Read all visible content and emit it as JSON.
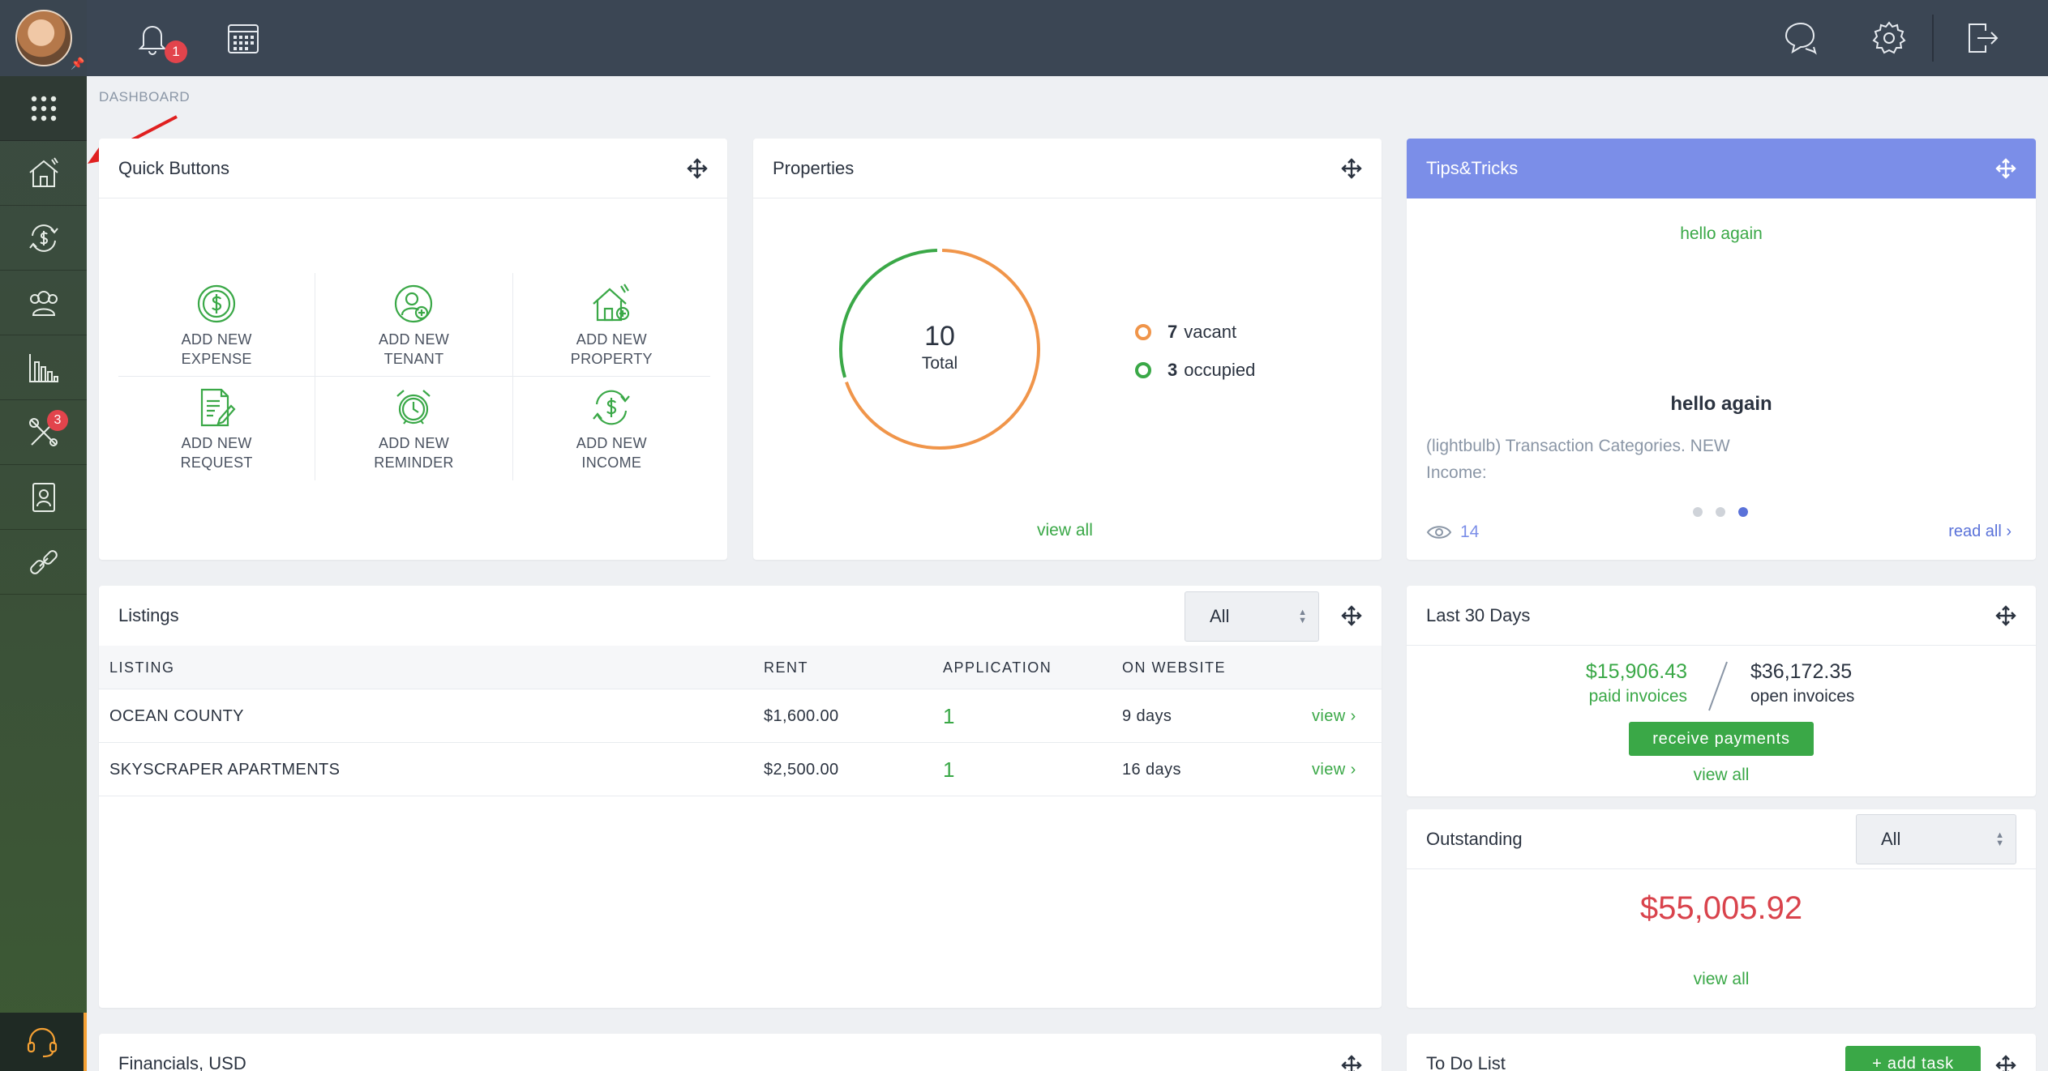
{
  "topbar": {
    "bell_count": "1"
  },
  "sidebar": {
    "tools_badge": "3"
  },
  "breadcrumb": "DASHBOARD",
  "quick_buttons": {
    "title": "Quick Buttons",
    "items": [
      {
        "line1": "ADD NEW",
        "line2": "EXPENSE"
      },
      {
        "line1": "ADD NEW",
        "line2": "TENANT"
      },
      {
        "line1": "ADD NEW",
        "line2": "PROPERTY"
      },
      {
        "line1": "ADD NEW",
        "line2": "REQUEST"
      },
      {
        "line1": "ADD NEW",
        "line2": "REMINDER"
      },
      {
        "line1": "ADD NEW",
        "line2": "INCOME"
      }
    ]
  },
  "properties": {
    "title": "Properties",
    "total_value": "10",
    "total_label": "Total",
    "vacant_count": "7",
    "vacant_label": "vacant",
    "occupied_count": "3",
    "occupied_label": "occupied",
    "view_all": "view all",
    "colors": {
      "vacant": "#f0954a",
      "occupied": "#3aa847"
    }
  },
  "tips": {
    "title": "Tips&Tricks",
    "top_text": "hello again",
    "heading": "hello again",
    "body_line1": "(lightbulb) Transaction Categories. NEW",
    "body_line2": "Income:",
    "views": "14",
    "read_all": "read all ›"
  },
  "listings": {
    "title": "Listings",
    "filter_value": "All",
    "columns": [
      "LISTING",
      "RENT",
      "APPLICATION",
      "ON WEBSITE"
    ],
    "rows": [
      {
        "listing": "OCEAN COUNTY",
        "rent": "$1,600.00",
        "application": "1",
        "on_website": "9 days",
        "action": "view ›"
      },
      {
        "listing": "SKYSCRAPER APARTMENTS",
        "rent": "$2,500.00",
        "application": "1",
        "on_website": "16 days",
        "action": "view ›"
      }
    ]
  },
  "last30": {
    "title": "Last 30 Days",
    "paid_amount": "$15,906.43",
    "paid_label": "paid invoices",
    "open_amount": "$36,172.35",
    "open_label": "open invoices",
    "button": "receive payments",
    "view_all": "view all"
  },
  "outstanding": {
    "title": "Outstanding",
    "filter_value": "All",
    "amount": "$55,005.92",
    "view_all": "view all"
  },
  "financials": {
    "title": "Financials, USD"
  },
  "todo": {
    "title": "To Do List",
    "button": "+ add task"
  }
}
